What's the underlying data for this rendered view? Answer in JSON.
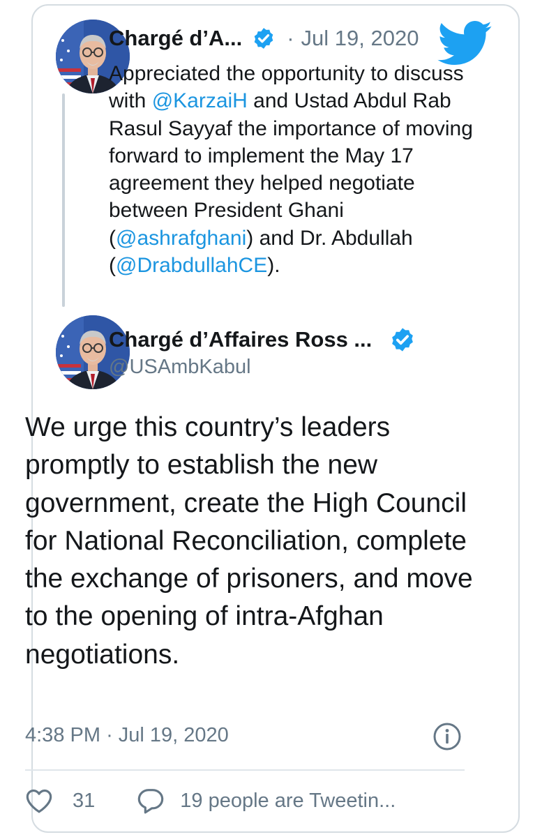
{
  "colors": {
    "link": "#1b95e0",
    "text": "#14171a",
    "muted": "#657786",
    "twitter_blue": "#1da1f2",
    "border": "#d5dce1"
  },
  "parent_tweet": {
    "author_name": "Chargé d’A...",
    "separator": "·",
    "date": "Jul 19, 2020",
    "avatar_icon": "profile-photo",
    "verified_icon": "verified-badge-icon",
    "brand_icon": "twitter-bird-icon",
    "text_parts": {
      "p1": "Appreciated the opportunity to discuss with ",
      "m1": "@KarzaiH",
      "p2": " and Ustad Abdul Rab Rasul Sayyaf the importance of moving forward to implement the May 17 agreement they helped negotiate between President Ghani (",
      "m2": "@ashrafghani",
      "p3": ") and Dr. Abdullah (",
      "m3": "@DrabdullahCE",
      "p4": ")."
    }
  },
  "main_tweet": {
    "author_name": "Chargé d’Affaires Ross ...",
    "handle": "@USAmbKabul",
    "text": "We urge this country’s leaders promptly to establish the new government, create the High Council for National Reconciliation, complete the exchange of prisoners, and move to the opening of intra-Afghan negotiations.",
    "time": "4:38 PM",
    "separator": "·",
    "date": "Jul 19, 2020",
    "info_icon": "info-icon",
    "likes": "31",
    "like_icon": "heart-icon",
    "reply_icon": "speech-bubble-icon",
    "conversation_label": "19 people are Tweetin..."
  }
}
